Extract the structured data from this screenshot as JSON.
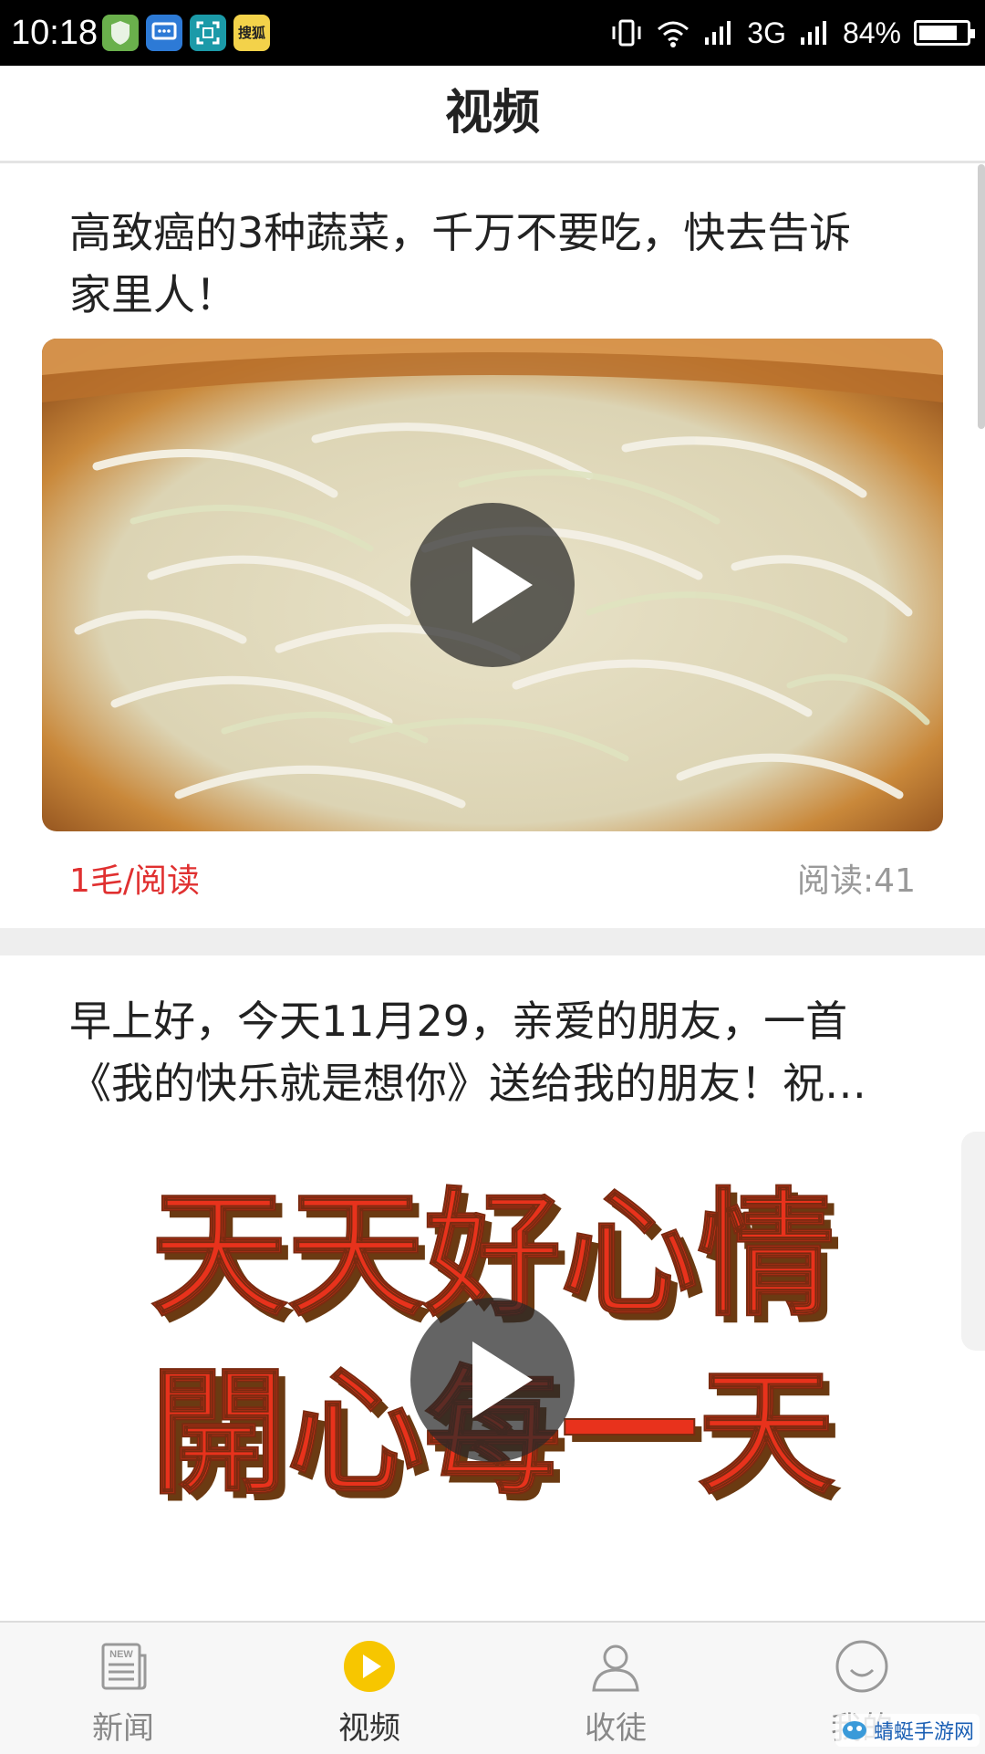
{
  "status_bar": {
    "time": "10:18",
    "network": "3G",
    "battery": "84%",
    "battery_level": 0.84,
    "app_icon_label": "搜狐"
  },
  "header": {
    "title": "视频"
  },
  "feed": [
    {
      "title": "高致癌的3种蔬菜，千万不要吃，快去告诉家里人！",
      "reward": "1毛/阅读",
      "reads": "阅读:41"
    },
    {
      "title": "早上好，今天11月29，亲爱的朋友，一首《我的快乐就是想你》送给我的朋友！祝…",
      "image_text_line1": "天天好心情",
      "image_text_line2": "開心每一天"
    }
  ],
  "bottom_nav": {
    "items": [
      {
        "label": "新闻",
        "icon": "newspaper-icon"
      },
      {
        "label": "视频",
        "icon": "play-circle-icon"
      },
      {
        "label": "收徒",
        "icon": "person-icon"
      },
      {
        "label": "我的",
        "icon": "smiley-icon"
      }
    ]
  },
  "watermark": {
    "text": "蜻蜓手游网"
  },
  "colors": {
    "accent": "#f7c600",
    "reward": "#e03030",
    "status_bar": "#000000",
    "separator": "#eeeeee"
  }
}
